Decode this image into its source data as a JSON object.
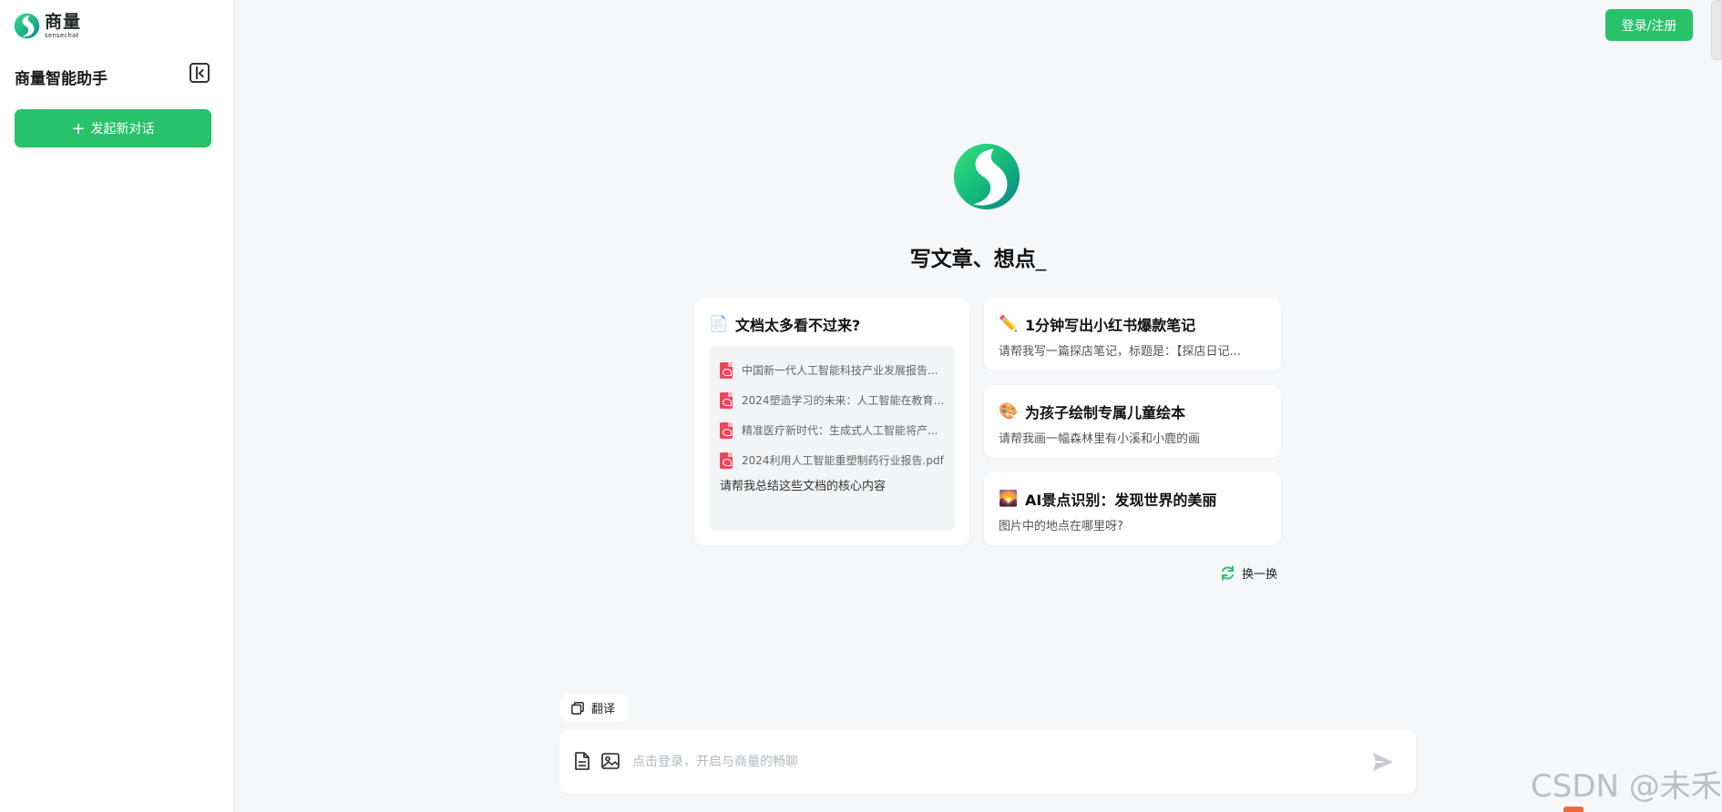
{
  "sidebar": {
    "brand_name": "商量",
    "brand_sub": "sensechat",
    "title": "商量智能助手",
    "new_chat_label": "发起新对话"
  },
  "header": {
    "login_label": "登录/注册"
  },
  "hero": {
    "title": "写文章、想点",
    "caret": "_"
  },
  "cards": {
    "docs": {
      "title": "文档太多看不过来?",
      "icon": "document-emoji",
      "files": [
        "中国新一代人工智能科技产业发展报告...",
        "2024塑造学习的未来：人工智能在教育4...",
        "精准医疗新时代：生成式人工智能将产...",
        "2024利用人工智能重塑制药行业报告.pdf"
      ],
      "prompt": "请帮我总结这些文档的核心内容"
    },
    "items": [
      {
        "emoji": "✏️",
        "icon": "pencil-emoji",
        "title": "1分钟写出小红书爆款笔记",
        "desc": "请帮我写一篇探店笔记，标题是：【探店日记..."
      },
      {
        "emoji": "🎨",
        "icon": "palette-emoji",
        "title": "为孩子绘制专属儿童绘本",
        "desc": "请帮我画一幅森林里有小溪和小鹿的画"
      },
      {
        "emoji": "🌄",
        "icon": "landscape-emoji",
        "title": "AI景点识别：发现世界的美丽",
        "desc": "图片中的地点在哪里呀?"
      }
    ]
  },
  "refresh_label": "换一换",
  "toolbar": {
    "translate_label": "翻译"
  },
  "input": {
    "placeholder": "点击登录，开启与商量的畅聊"
  },
  "watermark": "CSDN @未禾",
  "colors": {
    "accent": "#27c26a",
    "background": "#f6f7f9",
    "pdf_red": "#f0445c"
  }
}
